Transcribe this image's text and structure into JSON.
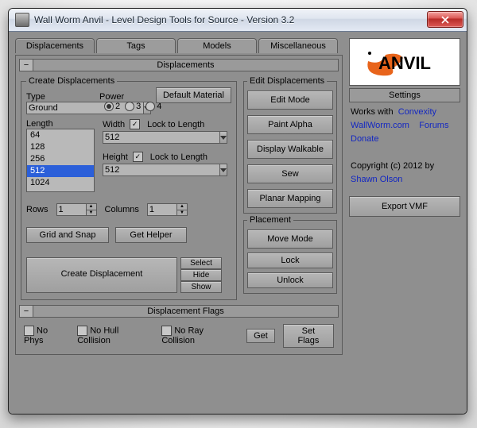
{
  "window": {
    "title": "Wall Worm Anvil - Level Design Tools for Source - Version 3.2"
  },
  "tabs": [
    "Displacements",
    "Tags",
    "Models",
    "Miscellaneous"
  ],
  "accordion_main": "Displacements",
  "create": {
    "legend": "Create Displacements",
    "default_material": "Default Material",
    "type_label": "Type",
    "type_value": "Ground",
    "power_label": "Power",
    "power_options": [
      "2",
      "3",
      "4"
    ],
    "length_label": "Length",
    "length_items": [
      "64",
      "128",
      "256",
      "512",
      "1024"
    ],
    "length_selected": "512",
    "width_label": "Width",
    "width_lock": "Lock to Length",
    "width_value": "512",
    "height_label": "Height",
    "height_lock": "Lock to Length",
    "height_value": "512",
    "rows_label": "Rows",
    "rows_value": "1",
    "cols_label": "Columns",
    "cols_value": "1",
    "grid_snap": "Grid and Snap",
    "get_helper": "Get Helper",
    "create_btn": "Create Displacement",
    "select": "Select",
    "hide": "Hide",
    "show": "Show"
  },
  "edit": {
    "legend": "Edit Displacements",
    "edit_mode": "Edit Mode",
    "paint_alpha": "Paint Alpha",
    "display_walkable": "Display Walkable",
    "sew": "Sew",
    "planar": "Planar Mapping"
  },
  "placement": {
    "legend": "Placement",
    "move": "Move Mode",
    "lock": "Lock",
    "unlock": "Unlock"
  },
  "flags": {
    "accordion": "Displacement Flags",
    "no_phys": "No Phys",
    "no_hull": "No Hull Collision",
    "no_ray": "No Ray Collision",
    "get": "Get",
    "set": "Set Flags"
  },
  "side": {
    "settings": "Settings",
    "works_with": "Works with",
    "convexity": "Convexity",
    "site": "WallWorm.com",
    "forums": "Forums",
    "donate": "Donate",
    "copyright": "Copyright (c) 2012 by",
    "author": "Shawn Olson",
    "export": "Export VMF",
    "logo_text": "ANVIL"
  }
}
